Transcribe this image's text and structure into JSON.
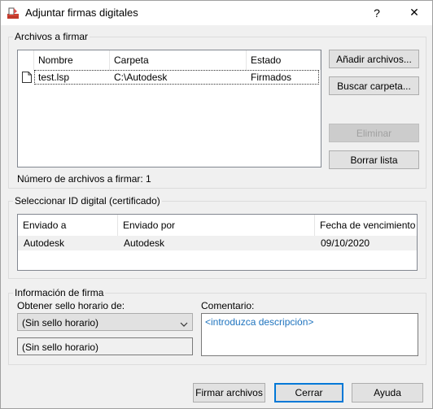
{
  "window": {
    "title": "Adjuntar firmas digitales",
    "help_glyph": "?",
    "close_glyph": "✕"
  },
  "files_group": {
    "label": "Archivos a firmar",
    "columns": [
      "Nombre",
      "Carpeta",
      "Estado"
    ],
    "rows": [
      {
        "name": "test.lsp",
        "folder": "C:\\Autodesk",
        "status": "Firmados"
      }
    ],
    "count_text": "Número de archivos a firmar: 1",
    "buttons": {
      "add_files": "Añadir archivos...",
      "find_folder": "Buscar carpeta...",
      "remove": "Eliminar",
      "clear_list": "Borrar lista"
    }
  },
  "id_group": {
    "label": "Seleccionar ID digital (certificado)",
    "columns": [
      "Enviado a",
      "Enviado por",
      "Fecha de vencimiento"
    ],
    "rows": [
      {
        "issued_to": "Autodesk",
        "issued_by": "Autodesk",
        "expires": "09/10/2020"
      }
    ]
  },
  "signature_group": {
    "label": "Información de firma",
    "timestamp_label": "Obtener sello horario de:",
    "timestamp_selected": "(Sin sello horario)",
    "timestamp_display": "(Sin sello horario)",
    "comment_label": "Comentario:",
    "comment_placeholder": "<introduzca descripción>"
  },
  "footer": {
    "sign_files": "Firmar archivos",
    "close": "Cerrar",
    "help": "Ayuda"
  },
  "colors": {
    "accent": "#0078d7",
    "placeholder_text": "#1e73be",
    "selected_row": "#f0f0f0"
  }
}
